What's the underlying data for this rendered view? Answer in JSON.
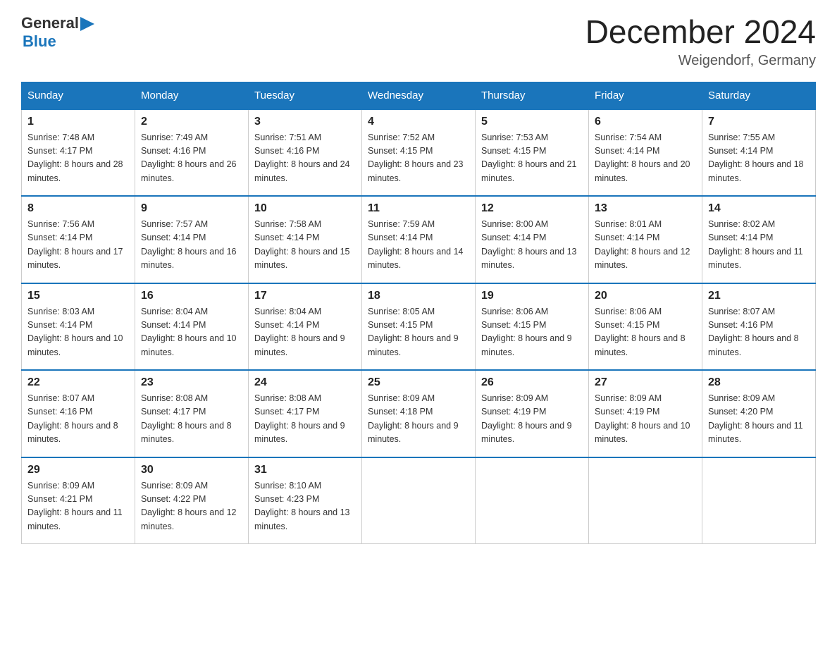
{
  "logo": {
    "general": "General",
    "blue": "Blue",
    "icon": "▶"
  },
  "title": "December 2024",
  "subtitle": "Weigendorf, Germany",
  "days_of_week": [
    "Sunday",
    "Monday",
    "Tuesday",
    "Wednesday",
    "Thursday",
    "Friday",
    "Saturday"
  ],
  "weeks": [
    [
      {
        "day": "1",
        "sunrise": "7:48 AM",
        "sunset": "4:17 PM",
        "daylight": "8 hours and 28 minutes."
      },
      {
        "day": "2",
        "sunrise": "7:49 AM",
        "sunset": "4:16 PM",
        "daylight": "8 hours and 26 minutes."
      },
      {
        "day": "3",
        "sunrise": "7:51 AM",
        "sunset": "4:16 PM",
        "daylight": "8 hours and 24 minutes."
      },
      {
        "day": "4",
        "sunrise": "7:52 AM",
        "sunset": "4:15 PM",
        "daylight": "8 hours and 23 minutes."
      },
      {
        "day": "5",
        "sunrise": "7:53 AM",
        "sunset": "4:15 PM",
        "daylight": "8 hours and 21 minutes."
      },
      {
        "day": "6",
        "sunrise": "7:54 AM",
        "sunset": "4:14 PM",
        "daylight": "8 hours and 20 minutes."
      },
      {
        "day": "7",
        "sunrise": "7:55 AM",
        "sunset": "4:14 PM",
        "daylight": "8 hours and 18 minutes."
      }
    ],
    [
      {
        "day": "8",
        "sunrise": "7:56 AM",
        "sunset": "4:14 PM",
        "daylight": "8 hours and 17 minutes."
      },
      {
        "day": "9",
        "sunrise": "7:57 AM",
        "sunset": "4:14 PM",
        "daylight": "8 hours and 16 minutes."
      },
      {
        "day": "10",
        "sunrise": "7:58 AM",
        "sunset": "4:14 PM",
        "daylight": "8 hours and 15 minutes."
      },
      {
        "day": "11",
        "sunrise": "7:59 AM",
        "sunset": "4:14 PM",
        "daylight": "8 hours and 14 minutes."
      },
      {
        "day": "12",
        "sunrise": "8:00 AM",
        "sunset": "4:14 PM",
        "daylight": "8 hours and 13 minutes."
      },
      {
        "day": "13",
        "sunrise": "8:01 AM",
        "sunset": "4:14 PM",
        "daylight": "8 hours and 12 minutes."
      },
      {
        "day": "14",
        "sunrise": "8:02 AM",
        "sunset": "4:14 PM",
        "daylight": "8 hours and 11 minutes."
      }
    ],
    [
      {
        "day": "15",
        "sunrise": "8:03 AM",
        "sunset": "4:14 PM",
        "daylight": "8 hours and 10 minutes."
      },
      {
        "day": "16",
        "sunrise": "8:04 AM",
        "sunset": "4:14 PM",
        "daylight": "8 hours and 10 minutes."
      },
      {
        "day": "17",
        "sunrise": "8:04 AM",
        "sunset": "4:14 PM",
        "daylight": "8 hours and 9 minutes."
      },
      {
        "day": "18",
        "sunrise": "8:05 AM",
        "sunset": "4:15 PM",
        "daylight": "8 hours and 9 minutes."
      },
      {
        "day": "19",
        "sunrise": "8:06 AM",
        "sunset": "4:15 PM",
        "daylight": "8 hours and 9 minutes."
      },
      {
        "day": "20",
        "sunrise": "8:06 AM",
        "sunset": "4:15 PM",
        "daylight": "8 hours and 8 minutes."
      },
      {
        "day": "21",
        "sunrise": "8:07 AM",
        "sunset": "4:16 PM",
        "daylight": "8 hours and 8 minutes."
      }
    ],
    [
      {
        "day": "22",
        "sunrise": "8:07 AM",
        "sunset": "4:16 PM",
        "daylight": "8 hours and 8 minutes."
      },
      {
        "day": "23",
        "sunrise": "8:08 AM",
        "sunset": "4:17 PM",
        "daylight": "8 hours and 8 minutes."
      },
      {
        "day": "24",
        "sunrise": "8:08 AM",
        "sunset": "4:17 PM",
        "daylight": "8 hours and 9 minutes."
      },
      {
        "day": "25",
        "sunrise": "8:09 AM",
        "sunset": "4:18 PM",
        "daylight": "8 hours and 9 minutes."
      },
      {
        "day": "26",
        "sunrise": "8:09 AM",
        "sunset": "4:19 PM",
        "daylight": "8 hours and 9 minutes."
      },
      {
        "day": "27",
        "sunrise": "8:09 AM",
        "sunset": "4:19 PM",
        "daylight": "8 hours and 10 minutes."
      },
      {
        "day": "28",
        "sunrise": "8:09 AM",
        "sunset": "4:20 PM",
        "daylight": "8 hours and 11 minutes."
      }
    ],
    [
      {
        "day": "29",
        "sunrise": "8:09 AM",
        "sunset": "4:21 PM",
        "daylight": "8 hours and 11 minutes."
      },
      {
        "day": "30",
        "sunrise": "8:09 AM",
        "sunset": "4:22 PM",
        "daylight": "8 hours and 12 minutes."
      },
      {
        "day": "31",
        "sunrise": "8:10 AM",
        "sunset": "4:23 PM",
        "daylight": "8 hours and 13 minutes."
      },
      null,
      null,
      null,
      null
    ]
  ],
  "labels": {
    "sunrise_prefix": "Sunrise: ",
    "sunset_prefix": "Sunset: ",
    "daylight_prefix": "Daylight: "
  }
}
